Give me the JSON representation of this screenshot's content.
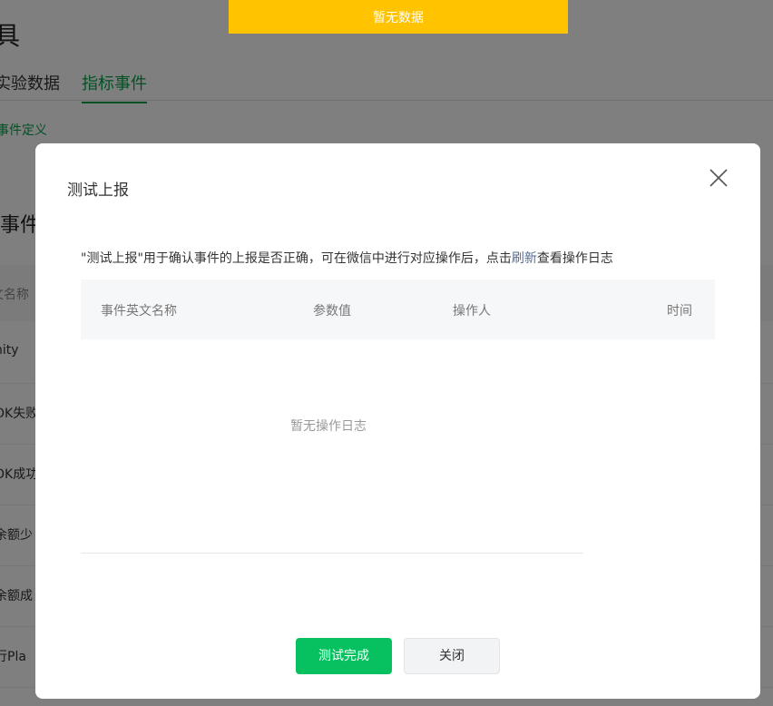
{
  "toast": {
    "text": "暂无数据"
  },
  "background": {
    "title_fragment": "具",
    "tabs": [
      {
        "label": "实验数据",
        "active": false
      },
      {
        "label": "指标事件",
        "active": true
      }
    ],
    "breadcrumb": "事件定义",
    "section_title": "事件",
    "table_header_fragment": "文名称",
    "rows": [
      "nity",
      "OK失败",
      "OK成功",
      "余额少",
      "余额成",
      "行Pla"
    ]
  },
  "modal": {
    "title": "测试上报",
    "description_before": "\"测试上报\"用于确认事件的上报是否正确，可在微信中进行对应操作后，点击",
    "description_link": "刷新",
    "description_after": "查看操作日志",
    "columns": [
      "事件英文名称",
      "参数值",
      "操作人",
      "时间"
    ],
    "empty_text": "暂无操作日志",
    "confirm_label": "测试完成",
    "close_label": "关闭"
  },
  "colors": {
    "toast_bg": "#ffc300",
    "primary": "#07c160",
    "link": "#576b95",
    "tab_active": "#07a34a"
  }
}
